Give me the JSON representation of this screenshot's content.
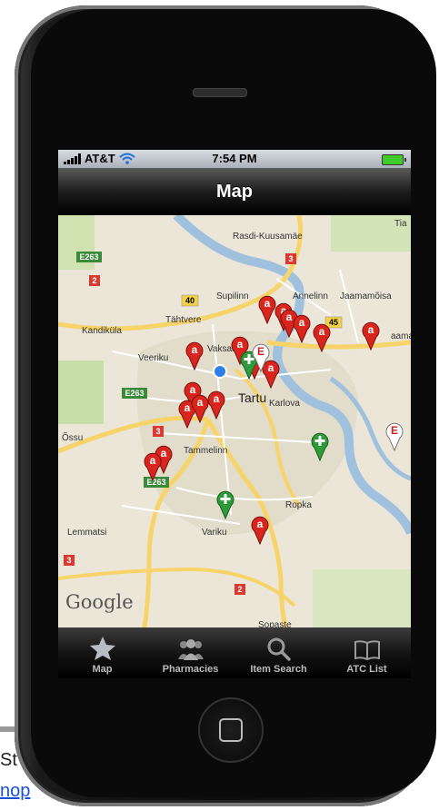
{
  "status_bar": {
    "carrier": "AT&T",
    "time": "7:54 PM"
  },
  "nav": {
    "title": "Map"
  },
  "map": {
    "attribution": "Google",
    "labels": {
      "rasdi": "Rasdi-Kuusamäe",
      "supilinn": "Supilinn",
      "annelinn": "Annelinn",
      "jaamamoisa": "Jaamamõisa",
      "kandikula": "Kandiküla",
      "tahtvere": "Tähtvere",
      "veeriku": "Veeriku",
      "vaksali": "Vaksali",
      "tartu": "Tartu",
      "karlova": "Karlova",
      "ossu": "Õssu",
      "tammelinn": "Tammelinn",
      "lemmatsi": "Lemmatsi",
      "variku": "Variku",
      "ropka": "Ropka",
      "sopaste": "Sopaste",
      "tia": "Tia",
      "aama": "aama"
    },
    "road_shields": {
      "e263_a": "E263",
      "e263_b": "E263",
      "e263_c": "E263",
      "r2_a": "2",
      "r2_b": "2",
      "r3_a": "3",
      "r3_b": "3",
      "r3_c": "3",
      "r40": "40",
      "r45": "45"
    },
    "pin_letters": {
      "pharmacy": "a",
      "euro": "E"
    }
  },
  "tabs": [
    {
      "label": "Map",
      "icon": "star-icon"
    },
    {
      "label": "Pharmacies",
      "icon": "people-icon"
    },
    {
      "label": "Item Search",
      "icon": "magnifier-icon"
    },
    {
      "label": "ATC List",
      "icon": "book-icon"
    }
  ],
  "page_fragment": {
    "text": "St",
    "link": "nop"
  }
}
